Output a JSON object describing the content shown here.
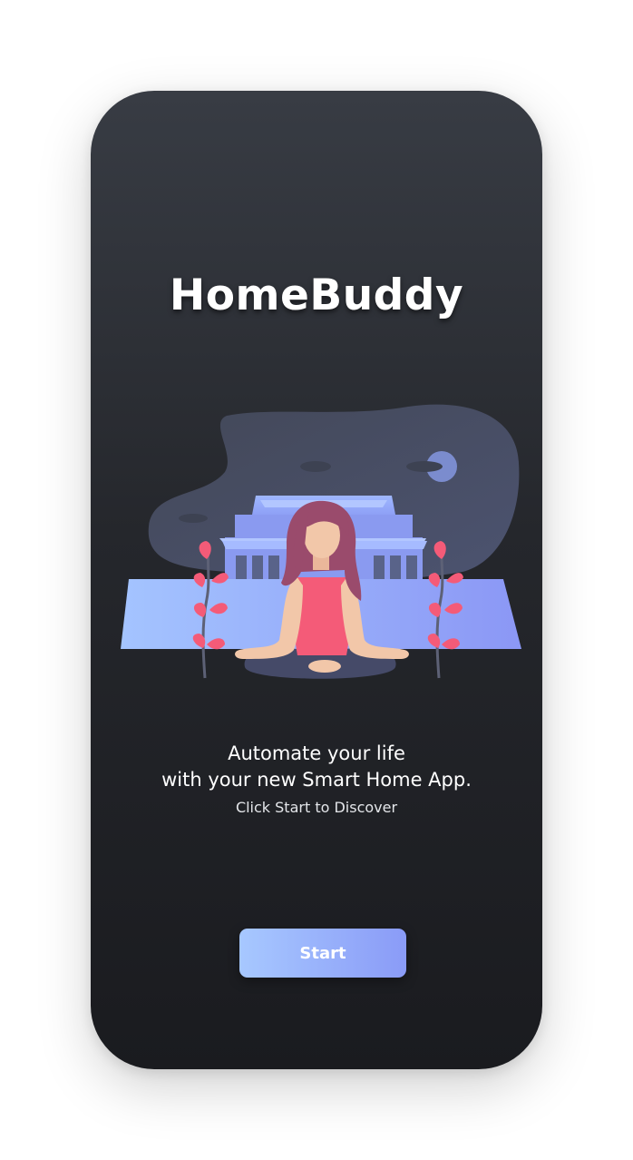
{
  "app": {
    "title": "HomeBuddy"
  },
  "onboarding": {
    "tagline_line1": "Automate your life",
    "tagline_line2": "with your new Smart Home App.",
    "subtext": "Click Start to Discover",
    "start_label": "Start"
  },
  "colors": {
    "background_top": "#383c44",
    "background_bottom": "#1a1b1f",
    "accent_start": "#a7c8ff",
    "accent_end": "#8a9bf7",
    "leaf": "#f45b78",
    "blob": "#4a5068"
  },
  "illustration": {
    "icon": "meditation-illustration"
  }
}
